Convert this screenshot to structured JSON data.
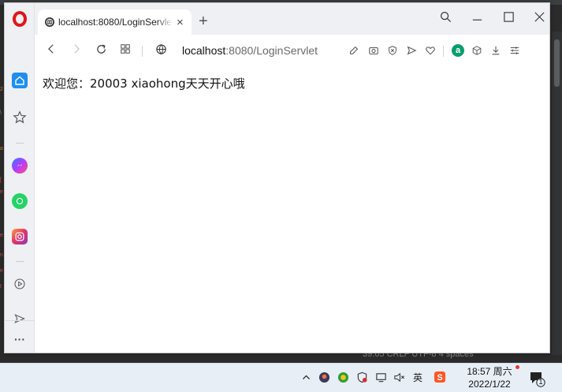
{
  "browser": {
    "tab_title": "localhost:8080/LoginServlet",
    "new_tab_symbol": "+",
    "close_tab_symbol": "×",
    "url_host": "localhost",
    "url_rest": ":8080/LoginServlet",
    "window_controls": {
      "search": "search-icon",
      "minimize": "minimize-icon",
      "maximize": "maximize-icon",
      "close": "close-icon"
    },
    "accent_color": "#e0161b"
  },
  "sidebar": {
    "items": [
      {
        "name": "home",
        "color": "#1e8ef2"
      },
      {
        "name": "pinboards",
        "color": "#555555"
      },
      {
        "name": "messenger",
        "color": "#7b4dff"
      },
      {
        "name": "whatsapp",
        "color": "#25d366"
      },
      {
        "name": "instagram",
        "color": "#e1306c"
      },
      {
        "name": "player",
        "color": "#555555"
      },
      {
        "name": "send",
        "color": "#555555"
      }
    ],
    "more_label": "···"
  },
  "page": {
    "greeting": "欢迎您：20003 xiaohong天天开心哦"
  },
  "ide": {
    "status_text": "39:65   CRLF   UTF-8   4 spaces"
  },
  "taskbar": {
    "time": "18:57 周六",
    "date": "2022/1/22",
    "ime_label": "英",
    "notification_count": "1"
  }
}
